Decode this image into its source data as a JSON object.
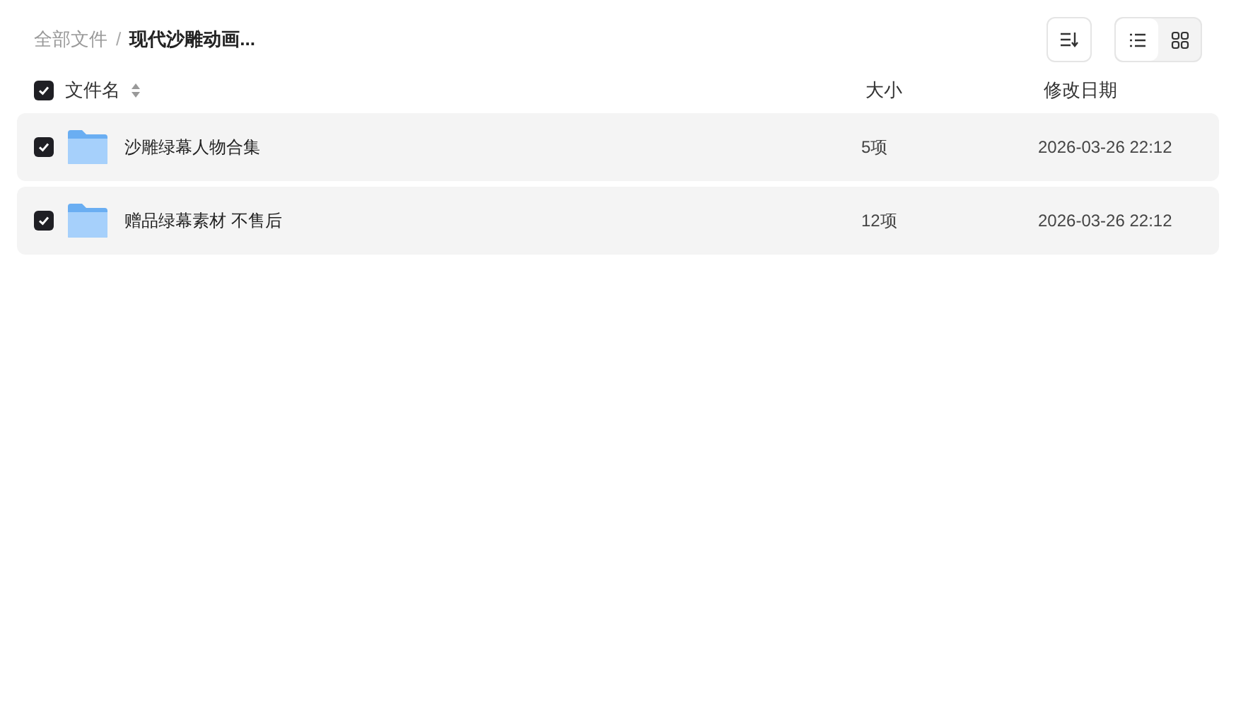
{
  "breadcrumb_separator": "/",
  "breadcrumb": [
    {
      "label": "全部文件",
      "current": false
    },
    {
      "label": "现代沙雕动画...",
      "current": true
    }
  ],
  "view_toggle": [
    {
      "kind": "list",
      "selected": true
    },
    {
      "kind": "grid",
      "selected": false
    }
  ],
  "table": {
    "select_all_checked": true,
    "columns": [
      "文件名",
      "大小",
      "修改日期"
    ],
    "rows": [
      {
        "name": "沙雕绿幕人物合集",
        "size": "5项",
        "modified": "2026-03-26 22:12",
        "checked": true
      },
      {
        "name": "赠品绿幕素材 不售后",
        "size": "12项",
        "modified": "2026-03-26 22:12",
        "checked": true
      }
    ]
  }
}
